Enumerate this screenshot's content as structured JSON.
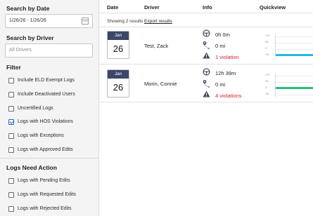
{
  "sidebar": {
    "search_by_date_title": "Search by Date",
    "date_range_value": "1/26/26 - 1/26/26",
    "search_by_driver_title": "Search by Driver",
    "driver_placeholder": "All Drivers",
    "filter_title": "Filter",
    "filters": [
      {
        "label": "Include ELD Exempt Logs",
        "checked": false
      },
      {
        "label": "Include Deactivated Users",
        "checked": false
      },
      {
        "label": "Uncertified Logs",
        "checked": false
      },
      {
        "label": "Logs with HOS Violations",
        "checked": true
      },
      {
        "label": "Logs with Exceptions",
        "checked": false
      },
      {
        "label": "Logs with Approved Edits",
        "checked": false
      }
    ],
    "logs_need_action_title": "Logs Need Action",
    "action_filters": [
      {
        "label": "Logs with Pending Edits",
        "checked": false
      },
      {
        "label": "Logs with Requested Edits",
        "checked": false
      },
      {
        "label": "Logs with Rejected Edits",
        "checked": false
      }
    ]
  },
  "table": {
    "headers": {
      "date": "Date",
      "driver": "Driver",
      "info": "Info",
      "quickview": "Quickview"
    },
    "results_text": "Showing 2 results",
    "export_label": "Export results",
    "rows": [
      {
        "month": "Jan",
        "day": "26",
        "driver": "Test, Zack",
        "drive_time": "0h 0m",
        "distance": "0 mi",
        "violations": "1 violation",
        "chart_labels": [
          "OFF",
          "SB",
          "D",
          "ON"
        ],
        "bar_color": "#29b6e0"
      },
      {
        "month": "Jan",
        "day": "26",
        "driver": "Morin, Connie",
        "drive_time": "12h 39m",
        "distance": "0 mi",
        "violations": "4 violations",
        "chart_labels": [
          "OFF",
          "SB",
          "D",
          "ON"
        ],
        "bar_color": "#2dbd78"
      }
    ]
  },
  "colors": {
    "accent": "#2d61c5",
    "badge_header": "#3c4669",
    "violation": "#d6232d"
  },
  "icons": {
    "drive_time": "steering-wheel-icon",
    "distance": "route-pin-icon",
    "violation": "warning-triangle-icon",
    "date_picker": "calendar-icon"
  }
}
